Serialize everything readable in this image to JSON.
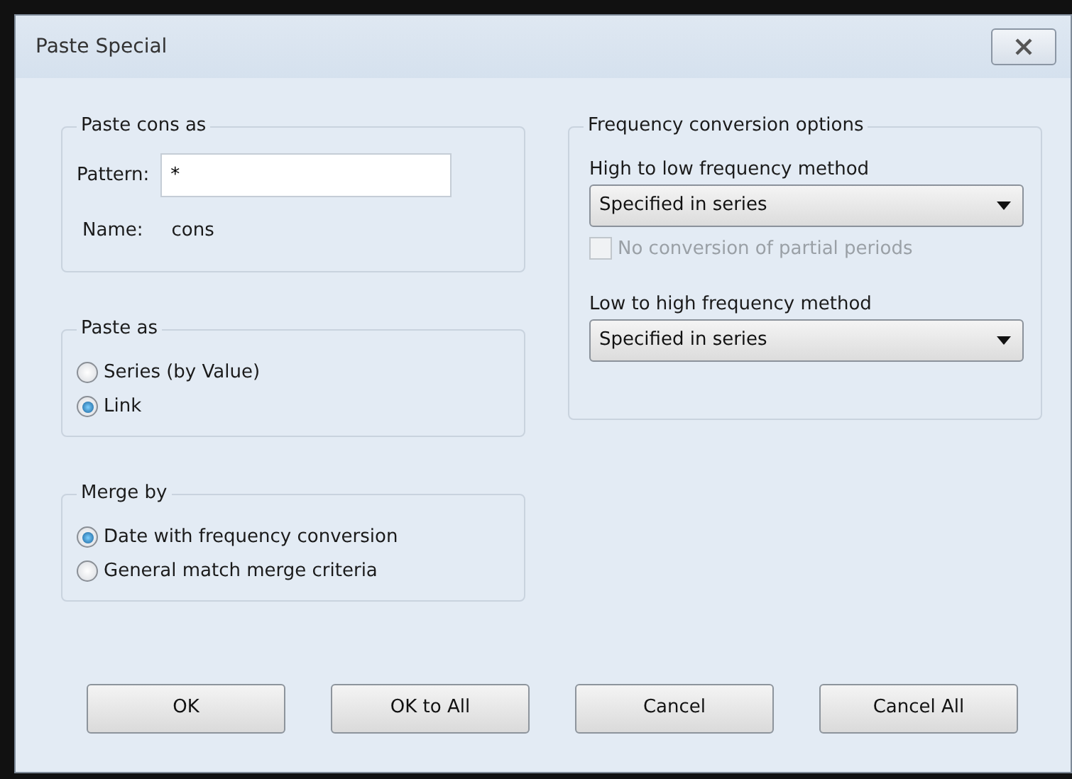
{
  "window": {
    "title": "Paste Special"
  },
  "paste_name_group": {
    "title": "Paste cons as",
    "pattern_label": "Pattern:",
    "pattern_value": "*",
    "name_label": "Name:",
    "name_value": "cons"
  },
  "paste_as": {
    "title": "Paste as",
    "options": [
      {
        "label": "Series (by Value)",
        "selected": false
      },
      {
        "label": "Link",
        "selected": true
      }
    ]
  },
  "merge_by": {
    "title": "Merge by",
    "options": [
      {
        "label": "Date with frequency conversion",
        "selected": true
      },
      {
        "label": "General match merge criteria",
        "selected": false
      }
    ]
  },
  "frequency": {
    "title": "Frequency conversion options",
    "high_to_low": {
      "label": "High to low frequency method",
      "value": "Specified in series"
    },
    "no_partial": {
      "label": "No conversion of partial periods",
      "checked": false,
      "disabled": true
    },
    "low_to_high": {
      "label": "Low to high frequency method",
      "value": "Specified in series"
    }
  },
  "buttons": [
    "OK",
    "OK to All",
    "Cancel",
    "Cancel All"
  ]
}
